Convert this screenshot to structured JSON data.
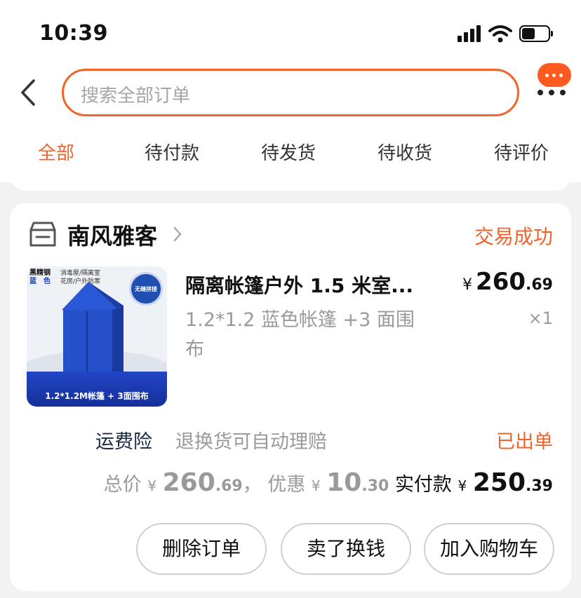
{
  "status_bar": {
    "time": "10:39"
  },
  "search": {
    "placeholder": "搜索全部订单"
  },
  "tabs": [
    {
      "label": "全部",
      "active": true
    },
    {
      "label": "待付款",
      "active": false
    },
    {
      "label": "待发货",
      "active": false
    },
    {
      "label": "待收货",
      "active": false
    },
    {
      "label": "待评价",
      "active": false
    }
  ],
  "order": {
    "shop_name": "南风雅客",
    "status": "交易成功",
    "product": {
      "title": "隔离帐篷户外 1.5 米室...",
      "sku": "1.2*1.2 蓝色帐篷 +3 面围布",
      "price": {
        "symbol": "¥",
        "int": "260",
        "dec": ".69"
      },
      "quantity": "×1",
      "image_text": {
        "brand_line1": "黑精钢",
        "brand_line2": "蓝　色",
        "desc_line1": "消毒屋/隔离室",
        "desc_line2": "花房/户外防寒",
        "seal": "无缝拼接",
        "caption": "1.2*1.2M帐篷 + 3面围布"
      }
    },
    "insurance": {
      "label": "运费险",
      "desc": "退换货可自动理赔",
      "status": "已出单"
    },
    "totals": {
      "total_label": "总价",
      "total_int": "260",
      "total_dec": ".69",
      "separator": "，",
      "discount_label": "优惠",
      "discount_int": "10",
      "discount_dec": ".30",
      "paid_label": "实付款",
      "paid_int": "250",
      "paid_dec": ".39",
      "symbol": "¥"
    },
    "buttons": {
      "delete": "删除订单",
      "resell": "卖了换钱",
      "add_cart": "加入购物车"
    }
  },
  "colors": {
    "accent": "#f0642b",
    "badge": "#ff5a1f",
    "muted": "#9a9a9a",
    "page_bg": "#f2f2f2"
  },
  "icons": [
    "back-icon",
    "signal-icon",
    "wifi-icon",
    "battery-icon",
    "message-icon",
    "more-icon",
    "store-icon",
    "chevron-right-icon"
  ]
}
